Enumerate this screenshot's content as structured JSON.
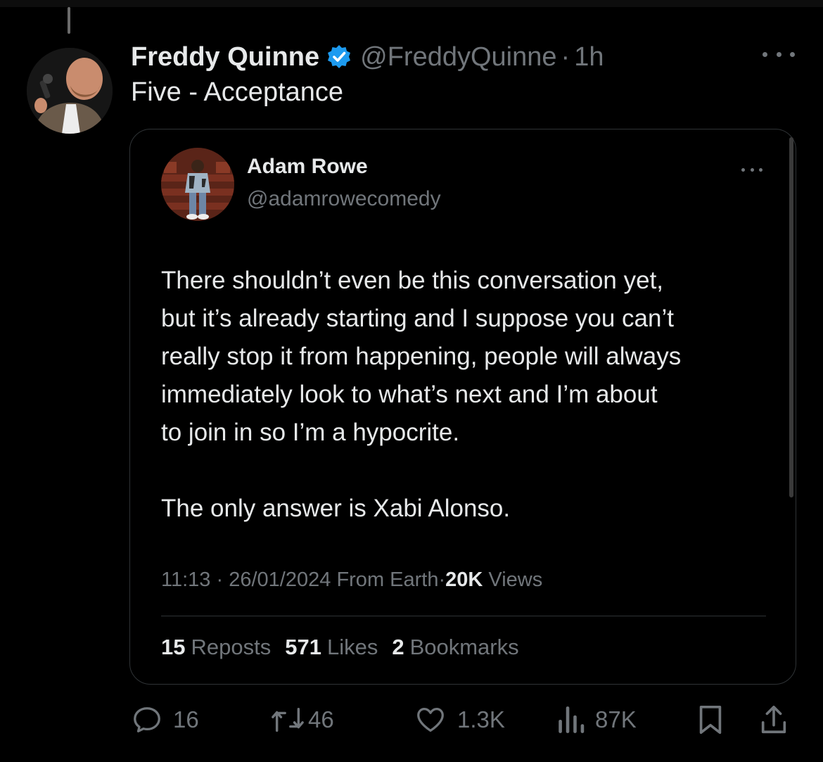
{
  "tweet": {
    "display_name": "Freddy Quinne",
    "handle": "@FreddyQuinne",
    "separator": "·",
    "time": "1h",
    "text": "Five - Acceptance",
    "verified_color": "#1d9bf0",
    "more_icon": "more-horizontal-icon"
  },
  "quote": {
    "display_name": "Adam Rowe",
    "handle": "@adamrowecomedy",
    "body": [
      "There shouldn’t even be this conversation yet,",
      "but it’s already starting and I suppose you can’t",
      "really stop it from happening, people will always",
      "immediately look to what’s next and I’m about",
      "to join in so I’m a hypocrite.",
      "The only answer is Xabi Alonso."
    ],
    "meta": {
      "time": "11:13",
      "sep1": "·",
      "date": "26/01/2024",
      "source": "From Earth",
      "sep2": "·",
      "views_count": "20K",
      "views_label": "Views"
    },
    "stats": {
      "reposts_count": "15",
      "reposts_label": "Reposts",
      "likes_count": "571",
      "likes_label": "Likes",
      "bookmarks_count": "2",
      "bookmarks_label": "Bookmarks"
    }
  },
  "actions": {
    "replies": "16",
    "reposts": "46",
    "likes": "1.3K",
    "views": "87K"
  },
  "colors": {
    "background": "#000000",
    "text_primary": "#e7e9ea",
    "text_secondary": "#71767b",
    "border": "#2f3336",
    "verified": "#1d9bf0"
  }
}
